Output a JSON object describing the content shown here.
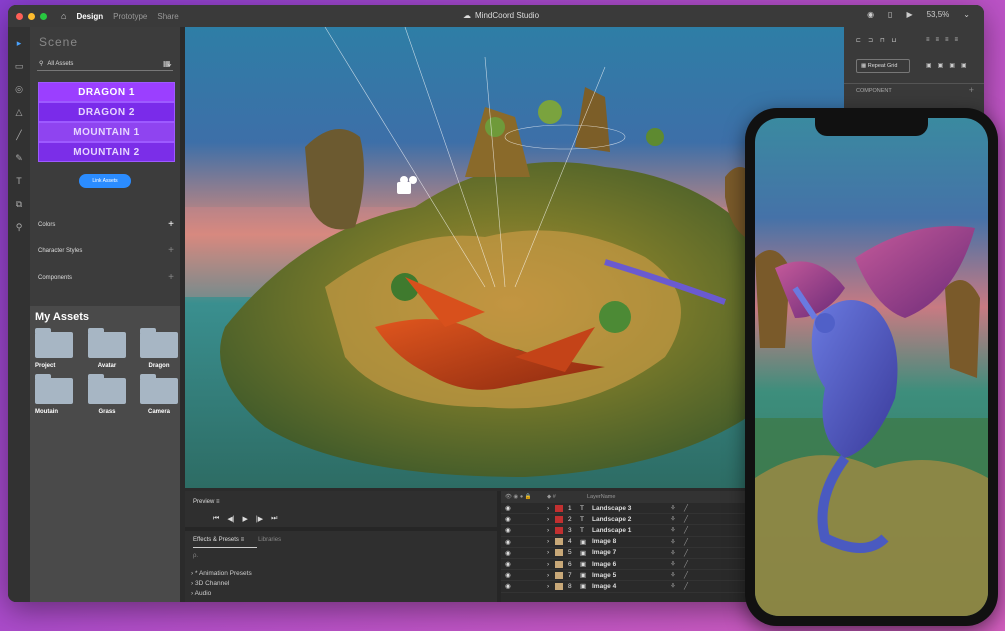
{
  "titlebar": {
    "tabs": [
      "Design",
      "Prototype",
      "Share"
    ],
    "title": "MindCoord Studio",
    "zoom": "53,5%",
    "traffic_lights": [
      "#ff5f57",
      "#febc2e",
      "#28c840"
    ]
  },
  "tools": [
    "select-arrow-icon",
    "rectangle-icon",
    "ellipse-icon",
    "triangle-icon",
    "line-icon",
    "pen-icon",
    "text-icon",
    "artboard-icon",
    "zoom-icon"
  ],
  "leftpanel": {
    "scene_title": "Scene",
    "filter_label": "All Assets",
    "characters": [
      "DRAGON 1",
      "DRAGON 2",
      "MOUNTAIN 1",
      "MOUNTAIN 2"
    ],
    "character_colors": [
      "#9b3fff",
      "#7a2bea",
      "#8f44f0",
      "#7b2ee8"
    ],
    "link_button": "Link Assets",
    "sections": [
      "Colors",
      "Character Styles",
      "Components"
    ],
    "my_assets_title": "My Assets",
    "folders": [
      "Project",
      "Avatar",
      "Dragon",
      "Moutain",
      "Grass",
      "Camera"
    ]
  },
  "preview": {
    "title": "Preview"
  },
  "effects": {
    "tabs": [
      "Effects & Presets",
      "Libraries"
    ],
    "search_placeholder": "ρ.",
    "items": [
      "* Animation Presets",
      "3D Channel",
      "Audio"
    ]
  },
  "layers": {
    "header_name": "LayerName",
    "rows": [
      {
        "num": "1",
        "type": "T",
        "name": "Landscape 3",
        "color": "#c23030"
      },
      {
        "num": "2",
        "type": "T",
        "name": "Landscape 2",
        "color": "#c23030"
      },
      {
        "num": "3",
        "type": "T",
        "name": "Landscape 1",
        "color": "#c23030"
      },
      {
        "num": "4",
        "type": "img",
        "name": "Image 8",
        "color": "#c8a878"
      },
      {
        "num": "5",
        "type": "img",
        "name": "Image 7",
        "color": "#c8a878"
      },
      {
        "num": "6",
        "type": "img",
        "name": "Image 6",
        "color": "#c8a878"
      },
      {
        "num": "7",
        "type": "img",
        "name": "Image 5",
        "color": "#c8a878"
      },
      {
        "num": "8",
        "type": "img",
        "name": "Image 4",
        "color": "#c8a878"
      }
    ]
  },
  "rightpanel": {
    "repeat_grid": "Repeat Grid",
    "component_label": "COMPONENT"
  }
}
